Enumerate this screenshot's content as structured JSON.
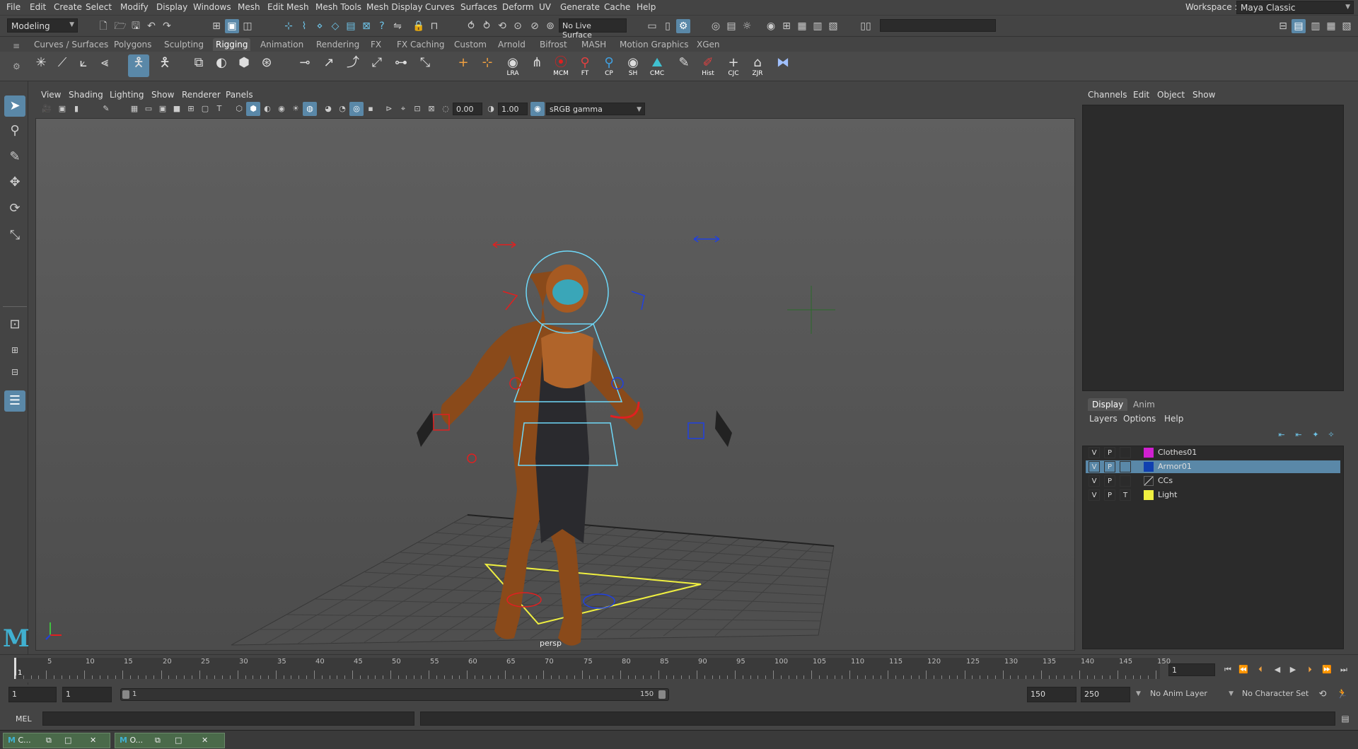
{
  "menubar": {
    "items": [
      "File",
      "Edit",
      "Create",
      "Select",
      "Modify",
      "Display",
      "Windows",
      "Mesh",
      "Edit Mesh",
      "Mesh Tools",
      "Mesh Display",
      "Curves",
      "Surfaces",
      "Deform",
      "UV",
      "Generate",
      "Cache",
      "Help"
    ],
    "workspace_label": "Workspace :",
    "workspace_value": "Maya Classic"
  },
  "statusline": {
    "mode": "Modeling",
    "live_surface": "No Live Surface"
  },
  "shelf": {
    "tabs": [
      "Curves / Surfaces",
      "Polygons",
      "Sculpting",
      "Rigging",
      "Animation",
      "Rendering",
      "FX",
      "FX Caching",
      "Custom",
      "Arnold",
      "Bifrost",
      "MASH",
      "Motion Graphics",
      "XGen"
    ],
    "active_tab": "Rigging",
    "buttons": [
      "LRA",
      "MCM",
      "FT",
      "CP",
      "SH",
      "CMC",
      "Hist",
      "CJC",
      "ZJR"
    ]
  },
  "viewport": {
    "menus": [
      "View",
      "Shading",
      "Lighting",
      "Show",
      "Renderer",
      "Panels"
    ],
    "exposure": "0.00",
    "gamma": "1.00",
    "color_space": "sRGB gamma",
    "camera_label": "persp"
  },
  "channel_box": {
    "menus": [
      "Channels",
      "Edit",
      "Object",
      "Show"
    ]
  },
  "layer_editor": {
    "tabs": [
      "Display",
      "Anim"
    ],
    "menus": [
      "Layers",
      "Options",
      "Help"
    ],
    "layers": [
      {
        "v": "V",
        "p": "P",
        "t": "",
        "name": "Clothes01",
        "color": "#d020d0",
        "selected": false
      },
      {
        "v": "V",
        "p": "P",
        "t": "",
        "name": "Armor01",
        "color": "#1040b0",
        "selected": true
      },
      {
        "v": "V",
        "p": "P",
        "t": "",
        "name": "CCs",
        "color": "",
        "selected": false
      },
      {
        "v": "V",
        "p": "P",
        "t": "T",
        "name": "Light",
        "color": "#f0f040",
        "selected": false
      }
    ]
  },
  "time_slider": {
    "tick_labels": [
      "5",
      "10",
      "15",
      "20",
      "25",
      "30",
      "35",
      "40",
      "45",
      "50",
      "55",
      "60",
      "65",
      "70",
      "75",
      "80",
      "85",
      "90",
      "95",
      "100",
      "105",
      "110",
      "115",
      "120",
      "125",
      "130",
      "135",
      "140",
      "145",
      "150"
    ],
    "first_frame_label": "1",
    "current_frame": "1"
  },
  "range_slider": {
    "start_time": "1",
    "playback_start": "1",
    "range_start_label": "1",
    "range_end_label": "150",
    "playback_end": "150",
    "end_time": "250",
    "anim_layer": "No Anim Layer",
    "character_set": "No Character Set"
  },
  "command_line": {
    "lang": "MEL"
  },
  "taskbar": {
    "items": [
      "C...",
      "O..."
    ]
  },
  "colors": {
    "accent": "#5a88a8",
    "rig_cyan": "#6ed8f8",
    "rig_red": "#e02020",
    "rig_blue": "#2040e0",
    "ground_yellow": "#f0f040"
  }
}
